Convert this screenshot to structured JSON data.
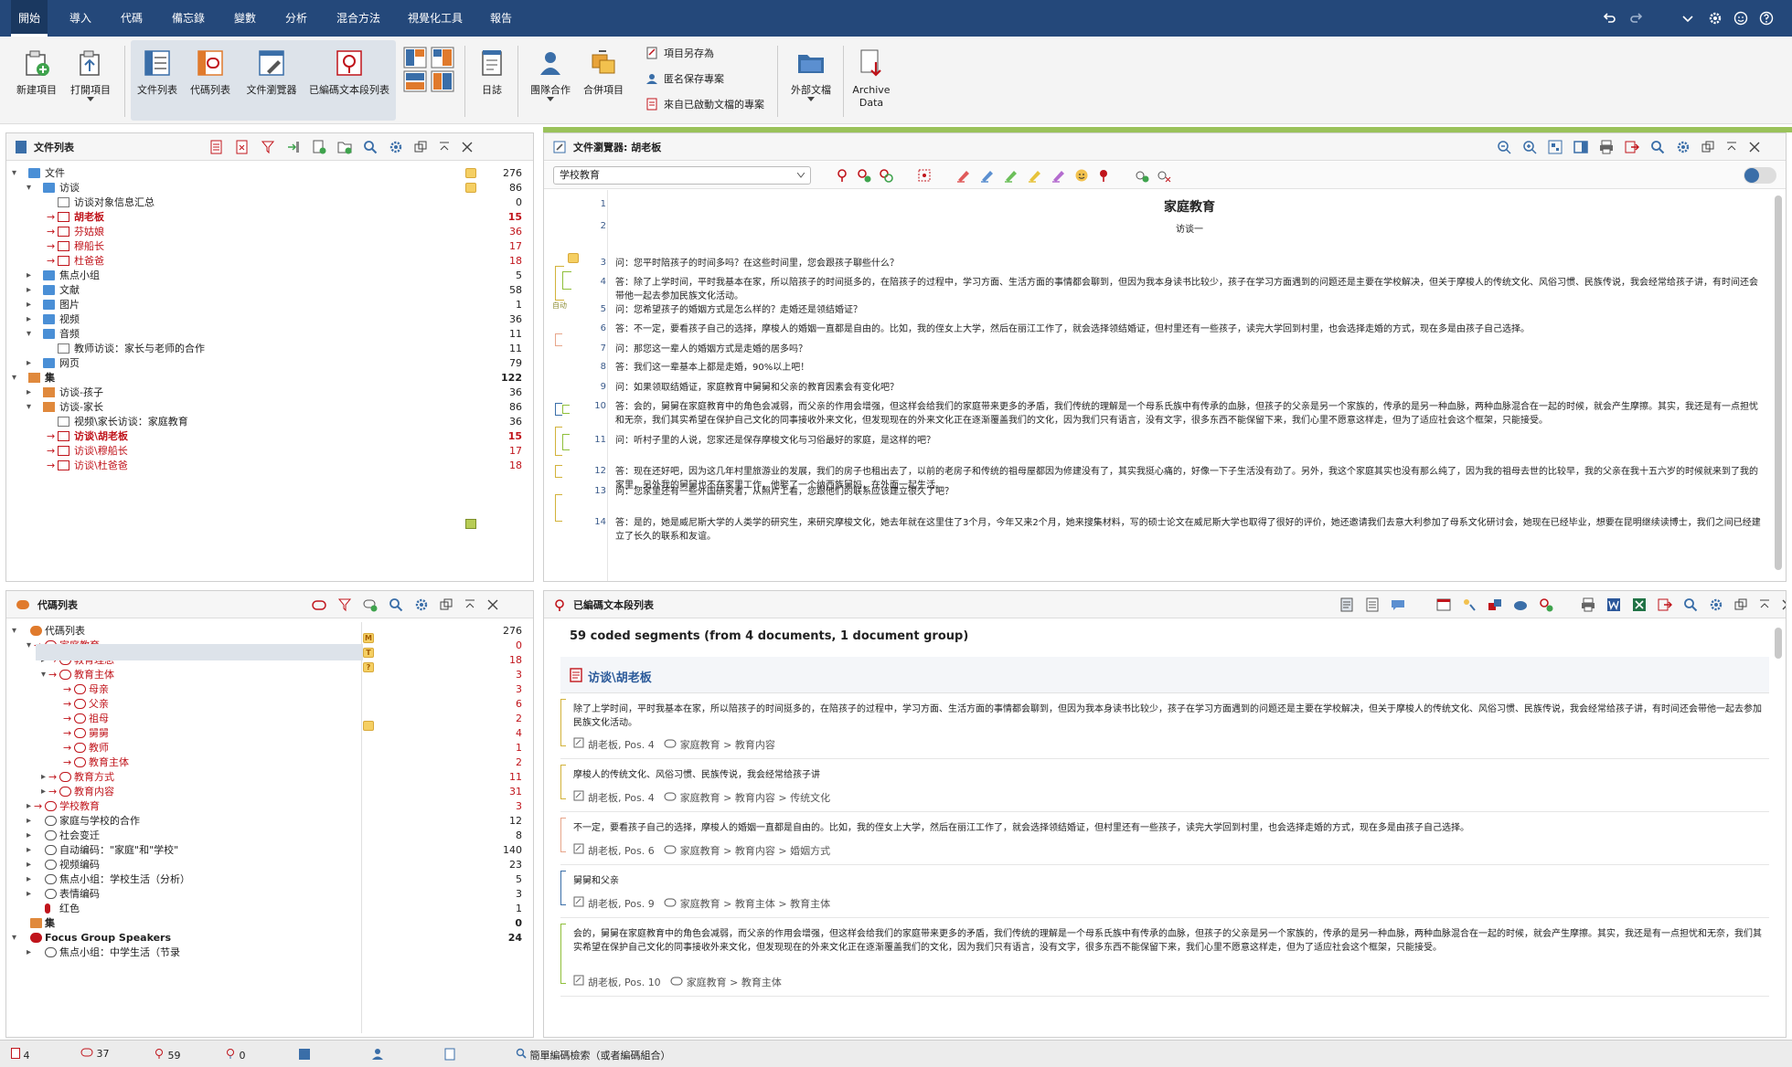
{
  "menu": {
    "items": [
      "開始",
      "導入",
      "代碼",
      "備忘錄",
      "變數",
      "分析",
      "混合方法",
      "視覺化工具",
      "報告"
    ]
  },
  "ribbon": {
    "new_project": "新建項目",
    "open_project": "打開項目",
    "doc_list": "文件列表",
    "code_list": "代碼列表",
    "doc_browser": "文件瀏覽器",
    "coded_segments": "已編碼文本段列表",
    "journal": "日誌",
    "teamwork": "團隊合作",
    "merge": "合併項目",
    "save_as": "項目另存為",
    "save_anon": "匿名保存專案",
    "from_backup": "來自已啟動文檔的專案",
    "external": "外部文檔",
    "archive": "Archive\nData"
  },
  "docs_panel": {
    "title": "文件列表",
    "rows": [
      {
        "label": "文件",
        "count": "276",
        "bold": false,
        "red": false
      },
      {
        "label": "访谈",
        "count": "86",
        "bold": false,
        "red": false
      },
      {
        "label": "访谈对象信息汇总",
        "count": "0",
        "bold": false,
        "red": false
      },
      {
        "label": "胡老板",
        "count": "15",
        "bold": true,
        "red": true
      },
      {
        "label": "芬姑娘",
        "count": "36",
        "bold": false,
        "red": true
      },
      {
        "label": "穆船长",
        "count": "17",
        "bold": false,
        "red": true
      },
      {
        "label": "杜爸爸",
        "count": "18",
        "bold": false,
        "red": true
      },
      {
        "label": "焦点小组",
        "count": "5",
        "bold": false,
        "red": false
      },
      {
        "label": "文献",
        "count": "58",
        "bold": false,
        "red": false
      },
      {
        "label": "图片",
        "count": "1",
        "bold": false,
        "red": false
      },
      {
        "label": "视频",
        "count": "36",
        "bold": false,
        "red": false
      },
      {
        "label": "音频",
        "count": "11",
        "bold": false,
        "red": false
      },
      {
        "label": "教师访谈：家长与老师的合作",
        "count": "11",
        "bold": false,
        "red": false
      },
      {
        "label": "网页",
        "count": "79",
        "bold": false,
        "red": false
      },
      {
        "label": "集",
        "count": "122",
        "bold": true,
        "red": false
      },
      {
        "label": "访谈-孩子",
        "count": "36",
        "bold": false,
        "red": false
      },
      {
        "label": "访谈-家长",
        "count": "86",
        "bold": false,
        "red": false
      },
      {
        "label": "视频\\家长访谈：家庭教育",
        "count": "36",
        "bold": false,
        "red": false
      },
      {
        "label": "访谈\\胡老板",
        "count": "15",
        "bold": true,
        "red": true
      },
      {
        "label": "访谈\\穆船长",
        "count": "17",
        "bold": false,
        "red": true
      },
      {
        "label": "访谈\\杜爸爸",
        "count": "18",
        "bold": false,
        "red": true
      }
    ]
  },
  "codes_panel": {
    "title": "代碼列表",
    "rows": [
      {
        "label": "代碼列表",
        "count": "276",
        "bold": false,
        "red": false
      },
      {
        "label": "家庭教育",
        "count": "0",
        "bold": false,
        "red": true
      },
      {
        "label": "教育理念",
        "count": "18",
        "bold": false,
        "red": true
      },
      {
        "label": "教育主体",
        "count": "3",
        "bold": false,
        "red": true
      },
      {
        "label": "母亲",
        "count": "3",
        "bold": false,
        "red": true
      },
      {
        "label": "父亲",
        "count": "6",
        "bold": false,
        "red": true
      },
      {
        "label": "祖母",
        "count": "2",
        "bold": false,
        "red": true
      },
      {
        "label": "舅舅",
        "count": "4",
        "bold": false,
        "red": true
      },
      {
        "label": "教师",
        "count": "1",
        "bold": false,
        "red": true
      },
      {
        "label": "教育主体",
        "count": "2",
        "bold": false,
        "red": true
      },
      {
        "label": "教育方式",
        "count": "11",
        "bold": false,
        "red": true
      },
      {
        "label": "教育内容",
        "count": "31",
        "bold": false,
        "red": true
      },
      {
        "label": "学校教育",
        "count": "3",
        "bold": false,
        "red": true
      },
      {
        "label": "家庭与学校的合作",
        "count": "12",
        "bold": false,
        "red": false
      },
      {
        "label": "社会变迁",
        "count": "8",
        "bold": false,
        "red": false
      },
      {
        "label": "自动编码：\"家庭\"和\"学校\"",
        "count": "140",
        "bold": false,
        "red": false
      },
      {
        "label": "视频编码",
        "count": "23",
        "bold": false,
        "red": false
      },
      {
        "label": "焦点小组：学校生活（分析）",
        "count": "5",
        "bold": false,
        "red": false
      },
      {
        "label": "表情编码",
        "count": "3",
        "bold": false,
        "red": false
      },
      {
        "label": "红色",
        "count": "1",
        "bold": false,
        "red": false
      },
      {
        "label": "集",
        "count": "0",
        "bold": true,
        "red": false
      },
      {
        "label": "Focus Group Speakers",
        "count": "24",
        "bold": true,
        "red": false
      },
      {
        "label": "焦点小组：中学生活（节录",
        "count": "",
        "bold": false,
        "red": false
      }
    ],
    "badges": {
      "m": "M",
      "t": "T",
      "q": "?"
    }
  },
  "browser_panel": {
    "title": "文件瀏覽器: 胡老板",
    "code_combo": "学校教育",
    "doc_title": "家庭教育",
    "doc_subtitle": "访谈一",
    "lines": [
      {
        "n": "3",
        "text": "问：您平时陪孩子的时间多吗？在这些时间里，您会跟孩子聊些什么？"
      },
      {
        "n": "4",
        "text": "答：除了上学时间，平时我基本在家，所以陪孩子的时间挺多的，在陪孩子的过程中，学习方面、生活方面的事情都会聊到，但因为我本身读书比较少，孩子在学习方面遇到的问题还是主要在学校解决，但关于摩梭人的传统文化、风俗习惯、民族传说，我会经常给孩子讲，有时间还会带他一起去参加民族文化活动。"
      },
      {
        "n": "5",
        "text": "问：您希望孩子的婚姻方式是怎么样的？走婚还是领结婚证？"
      },
      {
        "n": "6",
        "text": "答：不一定，要看孩子自己的选择，摩梭人的婚姻一直都是自由的。比如，我的侄女上大学，然后在丽江工作了，就会选择领结婚证，但村里还有一些孩子，读完大学回到村里，也会选择走婚的方式，现在多是由孩子自己选择。"
      },
      {
        "n": "7",
        "text": "问：那您这一辈人的婚姻方式是走婚的居多吗？"
      },
      {
        "n": "8",
        "text": "答：我们这一辈基本上都是走婚，90%以上吧！"
      },
      {
        "n": "9",
        "text": "问：如果领取结婚证，家庭教育中舅舅和父亲的教育因素会有变化吧？"
      },
      {
        "n": "10",
        "text": "答：会的，舅舅在家庭教育中的角色会减弱，而父亲的作用会增强，但这样会给我们的家庭带来更多的矛盾，我们传统的理解是一个母系氏族中有传承的血脉，但孩子的父亲是另一个家族的，传承的是另一种血脉，两种血脉混合在一起的时候，就会产生摩擦。其实，我还是有一点担忧和无奈，我们其实希望在保护自己文化的同事接收外来文化，但发现现在的外来文化正在逐渐覆盖我们的文化，因为我们只有语言，没有文字，很多东西不能保留下来，我们心里不愿意这样走，但为了适应社会这个框架，只能接受。"
      },
      {
        "n": "11",
        "text": "问：听村子里的人说，您家还是保存摩梭文化与习俗最好的家庭，是这样的吧？"
      },
      {
        "n": "12",
        "text": "答：现在还好吧，因为这几年村里旅游业的发展，我们的房子也租出去了，以前的老房子和传统的祖母屋都因为修建没有了，其实我挺心痛的，好像一下子生活没有劲了。另外，我这个家庭其实也没有那么纯了，因为我的祖母去世的比较早，我的父亲在我十五六岁的时候就来到了我的家里，另外我的舅舅也不在家里工作，他娶了一个纳西族舅妈，在外面一起生活。"
      },
      {
        "n": "13",
        "text": "问：您家里还有一些外国研究者，从照片上看，您跟他们的联系应该建立很久了吧？"
      },
      {
        "n": "14",
        "text": "答：是的，她是威尼斯大学的人类学的研究生，来研究摩梭文化，她去年就在这里住了3个月，今年又来2个月，她来搜集材料，写的硕士论文在威尼斯大学也取得了很好的评价，她还邀请我们去意大利参加了母系文化研讨会，她现在已经毕业，想要在昆明继续读博士，我们之间已经建立了长久的联系和友谊。"
      }
    ],
    "side_label": "自动"
  },
  "segments_panel": {
    "title": "已編碼文本段列表",
    "summary": "59 coded segments (from 4 documents, 1 document group)",
    "group_title": "访谈\\胡老板",
    "items": [
      {
        "text": "除了上学时间，平时我基本在家，所以陪孩子的时间挺多的，在陪孩子的过程中，学习方面、生活方面的事情都会聊到，但因为我本身读书比较少，孩子在学习方面遇到的问题还是主要在学校解决，但关于摩梭人的传统文化、风俗习惯、民族传说，我会经常给孩子讲，有时间还会带他一起去参加民族文化活动。",
        "doc": "胡老板, Pos. 4",
        "code": "家庭教育 > 教育内容"
      },
      {
        "text": "摩梭人的传统文化、风俗习惯、民族传说，我会经常给孩子讲",
        "doc": "胡老板, Pos. 4",
        "code": "家庭教育 > 教育内容 > 传统文化"
      },
      {
        "text": "不一定，要看孩子自己的选择，摩梭人的婚姻一直都是自由的。比如，我的侄女上大学，然后在丽江工作了，就会选择领结婚证，但村里还有一些孩子，读完大学回到村里，也会选择走婚的方式，现在多是由孩子自己选择。",
        "doc": "胡老板, Pos. 6",
        "code": "家庭教育 > 教育内容 > 婚姻方式"
      },
      {
        "text": "舅舅和父亲",
        "doc": "胡老板, Pos. 9",
        "code": "家庭教育 > 教育主体 > 教育主体"
      },
      {
        "text": "会的，舅舅在家庭教育中的角色会减弱，而父亲的作用会增强，但这样会给我们的家庭带来更多的矛盾，我们传统的理解是一个母系氏族中有传承的血脉，但孩子的父亲是另一个家族的，传承的是另一种血脉，两种血脉混合在一起的时候，就会产生摩擦。其实，我还是有一点担忧和无奈，我们其实希望在保护自己文化的同事接收外来文化，但发现现在的外来文化正在逐渐覆盖我们的文化，因为我们只有语言，没有文字，很多东西不能保留下来，我们心里不愿意这样走，但为了适应社会这个框架，只能接受。",
        "doc": "胡老板, Pos. 10",
        "code": "家庭教育 > 教育主体"
      }
    ]
  },
  "status": {
    "docs": "4",
    "codes": "37",
    "segments": "59",
    "memos": "0",
    "search": "簡單編碼檢索（或者編碼組合）"
  },
  "colors": {
    "menubar": "#24487a",
    "accent_green": "#9ac25a",
    "code_red": "#c0141b",
    "folder_blue": "#4a8fd6"
  }
}
